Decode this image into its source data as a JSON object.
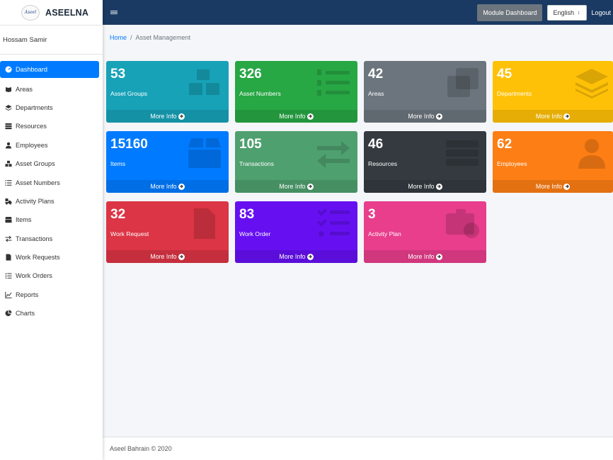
{
  "brand": {
    "name": "ASEELNA",
    "logo_text": "Aseel"
  },
  "user": {
    "name": "Hossam Samir"
  },
  "sidebar": {
    "items": [
      {
        "label": "Dashboard",
        "icon": "dashboard-icon",
        "active": true
      },
      {
        "label": "Areas",
        "icon": "book-icon"
      },
      {
        "label": "Departments",
        "icon": "layers-icon"
      },
      {
        "label": "Resources",
        "icon": "server-icon"
      },
      {
        "label": "Employees",
        "icon": "user-tie-icon"
      },
      {
        "label": "Asset Groups",
        "icon": "boxes-icon"
      },
      {
        "label": "Asset Numbers",
        "icon": "list-ol-icon"
      },
      {
        "label": "Activity Plans",
        "icon": "truck-loading-icon"
      },
      {
        "label": "Items",
        "icon": "box-icon"
      },
      {
        "label": "Transactions",
        "icon": "exchange-icon"
      },
      {
        "label": "Work Requests",
        "icon": "file-icon"
      },
      {
        "label": "Work Orders",
        "icon": "tasks-icon"
      },
      {
        "label": "Reports",
        "icon": "chart-line-icon"
      },
      {
        "label": "Charts",
        "icon": "chart-pie-icon"
      }
    ]
  },
  "navbar": {
    "module_dashboard": "Module Dashboard",
    "language": "English",
    "language_arrow": "↕",
    "logout": "Logout"
  },
  "breadcrumb": {
    "home": "Home",
    "separator": "/",
    "current": "Asset Management"
  },
  "cards": [
    {
      "value": "53",
      "label": "Asset Groups",
      "more": "More Info",
      "color": "#17a2b8",
      "icon": "boxes-icon"
    },
    {
      "value": "326",
      "label": "Asset Numbers",
      "more": "More Info",
      "color": "#28a745",
      "icon": "list-ol-icon"
    },
    {
      "value": "42",
      "label": "Areas",
      "more": "More Info",
      "color": "#6c757d",
      "icon": "clone-icon"
    },
    {
      "value": "45",
      "label": "Departments",
      "more": "More Info",
      "color": "#ffc107",
      "icon": "layers-icon"
    },
    {
      "value": "15160",
      "label": "Items",
      "more": "More Info",
      "color": "#007bff",
      "icon": "box-icon"
    },
    {
      "value": "105",
      "label": "Transactions",
      "more": "More Info",
      "color": "#4fa06f",
      "icon": "exchange-icon"
    },
    {
      "value": "46",
      "label": "Resources",
      "more": "More Info",
      "color": "#343a40",
      "icon": "server-icon"
    },
    {
      "value": "62",
      "label": "Employees",
      "more": "More Info",
      "color": "#fd7e14",
      "icon": "user-tie-icon"
    },
    {
      "value": "32",
      "label": "Work Request",
      "more": "More Info",
      "color": "#dc3545",
      "icon": "file-icon"
    },
    {
      "value": "83",
      "label": "Work Order",
      "more": "More Info",
      "color": "#6610f2",
      "icon": "tasks-icon"
    },
    {
      "value": "3",
      "label": "Activity Plan",
      "more": "More Info",
      "color": "#e83e8c",
      "icon": "business-time-icon"
    }
  ],
  "footer": {
    "text": "Aseel Bahrain © 2020"
  }
}
